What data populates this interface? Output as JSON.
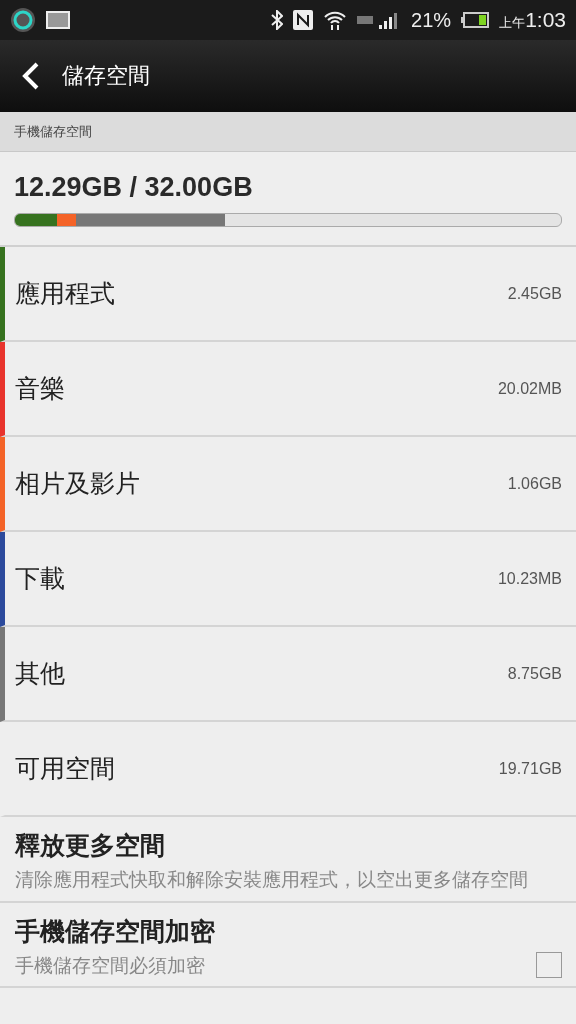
{
  "status_bar": {
    "battery": "21%",
    "time_prefix": "上午",
    "time": "1:03"
  },
  "action_bar": {
    "title": "儲存空間"
  },
  "section_header": "手機儲存空間",
  "summary": {
    "total": "12.29GB / 32.00GB",
    "segments": [
      {
        "level": 0.077,
        "color": "#36721f"
      },
      {
        "level": 0.035,
        "color": "#f46327"
      },
      {
        "level": 0.272,
        "color": "#777777"
      }
    ]
  },
  "categories": [
    {
      "label": "應用程式",
      "size": "2.45GB",
      "color": "#36721f"
    },
    {
      "label": "音樂",
      "size": "20.02MB",
      "color": "#e8332c"
    },
    {
      "label": "相片及影片",
      "size": "1.06GB",
      "color": "#f46327"
    },
    {
      "label": "下載",
      "size": "10.23MB",
      "color": "#2c4a9c"
    },
    {
      "label": "其他",
      "size": "8.75GB",
      "color": "#777777"
    },
    {
      "label": "可用空間",
      "size": "19.71GB"
    }
  ],
  "settings": [
    {
      "kind": "action",
      "title": "釋放更多空間",
      "summary": "清除應用程式快取和解除安裝應用程式，以空出更多儲存空間"
    },
    {
      "kind": "checkbox",
      "title": "手機儲存空間加密",
      "summary": "手機儲存空間必須加密",
      "checked": false
    }
  ]
}
